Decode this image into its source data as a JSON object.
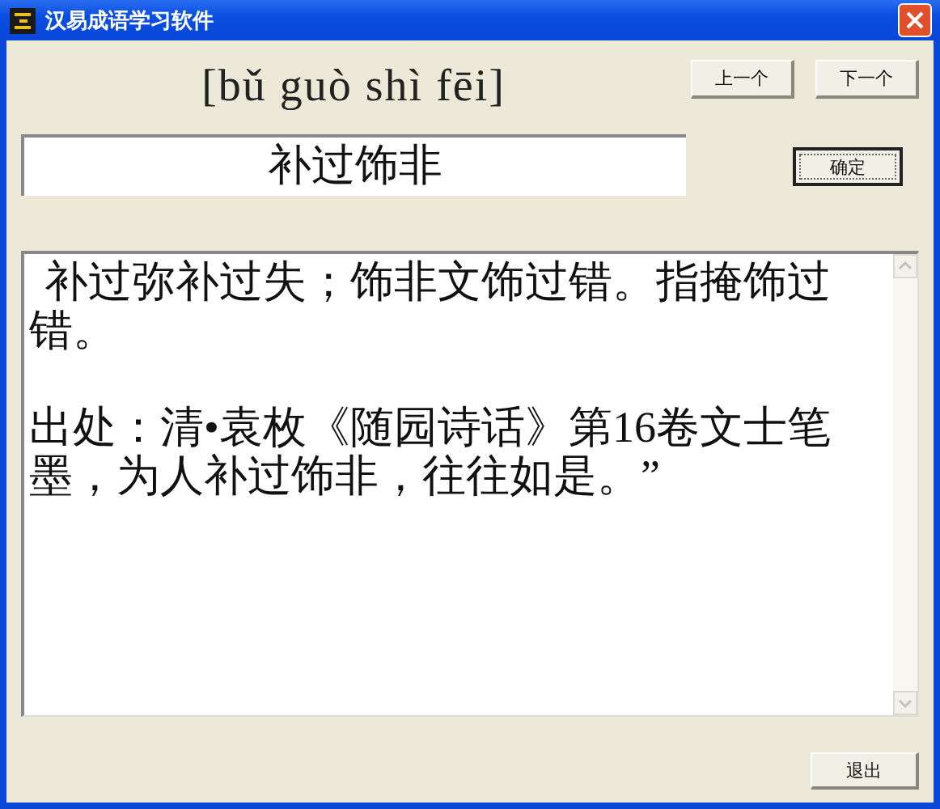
{
  "window": {
    "title": "汉易成语学习软件"
  },
  "pinyin": "[bǔ guò shì fēi]",
  "nav_buttons": [
    "上一个",
    "下一个"
  ],
  "idiom_field": {
    "value": "补过饰非"
  },
  "confirm_button": {
    "label": "确定",
    "focused": true
  },
  "explanation": {
    "paragraphs": [
      "补过弥补过失；饰非文饰过错。指掩饰过错。",
      "出处：清•袁枚《随园诗话》第16卷文士笔墨，为人补过饰非，往往如是。”"
    ]
  },
  "exit_button": "退出"
}
